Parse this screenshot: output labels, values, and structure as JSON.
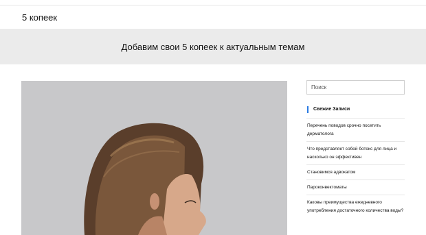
{
  "header": {
    "site_title": "5 копеек"
  },
  "hero": {
    "tagline": "Добавим свои 5 копеек к актуальным темам"
  },
  "sidebar": {
    "search": {
      "placeholder": "Поиск"
    },
    "recent": {
      "title": "Свежие Записи",
      "items": [
        {
          "label": "Перечень поводов срочно посетить дерматолога"
        },
        {
          "label": "Что представляет собой ботокс для лица и насколько он эффективен"
        },
        {
          "label": "Становимся адвокатом"
        },
        {
          "label": "Пароконвектоматы"
        },
        {
          "label": "Каковы преимущества ежедневного употребления достаточного количества воды?"
        }
      ]
    }
  },
  "colors": {
    "accent": "#2a7ae2",
    "hero_bg": "#ebebeb",
    "image_bg": "#c6c6c8"
  }
}
